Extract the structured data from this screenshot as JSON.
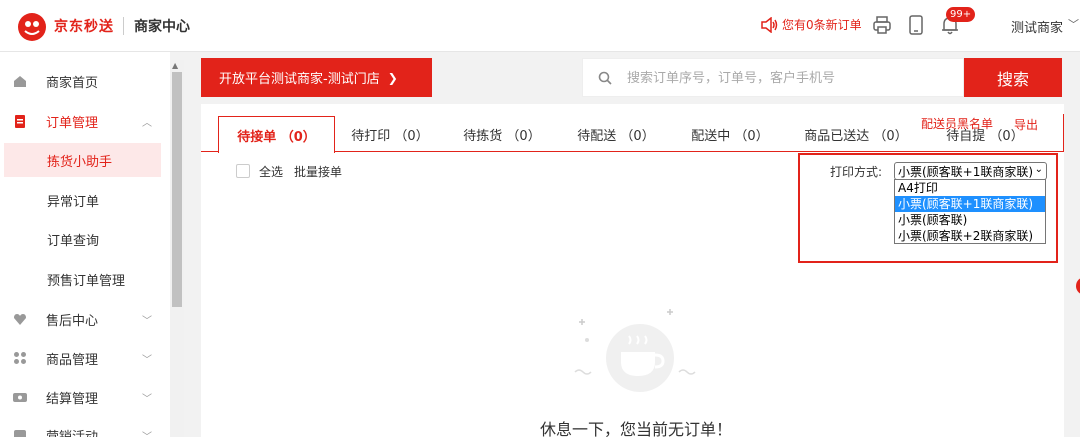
{
  "header": {
    "brand": "京东秒送",
    "center_title": "商家中心",
    "notification": "您有0条新订单",
    "badge": "99+",
    "user": "测试商家",
    "user_caret": "﹀"
  },
  "sidebar": {
    "items": [
      {
        "label": "商家首页",
        "icon": "home-icon"
      },
      {
        "label": "订单管理",
        "icon": "order-icon",
        "chevron": "︿"
      },
      {
        "label": "售后中心",
        "icon": "aftersale-icon",
        "chevron": "﹀"
      },
      {
        "label": "商品管理",
        "icon": "grid-icon",
        "chevron": "﹀"
      },
      {
        "label": "结算管理",
        "icon": "settle-icon",
        "chevron": "﹀"
      },
      {
        "label": "营销活动",
        "icon": "marketing-icon",
        "chevron": "﹀"
      }
    ],
    "sub_items": [
      {
        "label": "拣货小助手",
        "active": true
      },
      {
        "label": "异常订单"
      },
      {
        "label": "订单查询"
      },
      {
        "label": "预售订单管理"
      }
    ]
  },
  "toolbar": {
    "store": "开放平台测试商家-测试门店",
    "store_chevron": "❯",
    "search_placeholder": "搜索订单序号，订单号，客户手机号",
    "search_button": "搜索"
  },
  "links": {
    "rider_blacklist": "配送员黑名单",
    "export": "导出"
  },
  "tabs": [
    {
      "label": "待接单 （0）"
    },
    {
      "label": "待打印 （0）"
    },
    {
      "label": "待拣货 （0）"
    },
    {
      "label": "待配送 （0）"
    },
    {
      "label": "配送中 （0）"
    },
    {
      "label": "商品已送达 （0）"
    },
    {
      "label": "待自提 （0）"
    }
  ],
  "actions": {
    "select_all": "全选",
    "batch_accept": "批量接单"
  },
  "print": {
    "label": "打印方式:",
    "selected": "小票(顾客联+1联商家联)",
    "options": [
      "A4打印",
      "小票(顾客联+1联商家联)",
      "小票(顾客联)",
      "小票(顾客联+2联商家联)"
    ]
  },
  "empty": {
    "message": "休息一下，您当前无订单！"
  },
  "colors": {
    "accent": "#e2231a",
    "selected_option": "#1e90ff"
  }
}
